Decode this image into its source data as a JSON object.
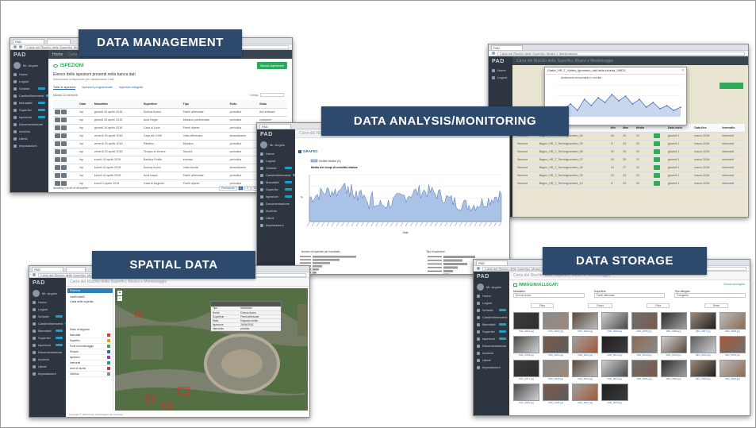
{
  "banners": {
    "data_management": "DATA MANAGEMENT",
    "data_analysis": "DATA ANALYSIS/MONITORING",
    "spatial_data": "SPATIAL DATA",
    "data_storage": "DATA STORAGE"
  },
  "app": {
    "logo": "PAD",
    "user_name": "Mr. Angelo",
    "user_sub": "Online",
    "header_title": "Carta del Rischio delle Superfici, Musivi e Monitoraggio",
    "nav": [
      "Home",
      "Logout",
      "Schede",
      "Cantieri/Interventi",
      "Manufatti",
      "Superfici",
      "Ispezioni",
      "Documentazione",
      "Archivio",
      "Utenti",
      "Impostazioni"
    ]
  },
  "management": {
    "section_title": "ISPEZIONI",
    "add_button": "Nuova Ispezione",
    "list_heading": "Elenco delle ispezioni presenti nella banca dati",
    "list_sub": "Selezionare un'ispezione per visualizzarne i dati",
    "tabs": [
      "Tutte le ispezioni",
      "Ispezioni programmate",
      "Ispezioni eseguite"
    ],
    "search_label": "Cerca:",
    "show_label": "Mostra 10 elementi",
    "columns": [
      "",
      "Data",
      "Manufatto",
      "Superficie",
      "Tipo",
      "Esito",
      "Stato"
    ],
    "rows": [
      [
        "Isp",
        "giovedì 26 aprile 2018",
        "Domus Aurea",
        "Pareti affrescate",
        "periodica",
        "da verificare"
      ],
      [
        "Isp",
        "giovedì 26 aprile 2018",
        "Aula Regia",
        "Mosaico pavimentale",
        "periodica",
        "conforme"
      ],
      [
        "Isp",
        "giovedì 26 aprile 2018",
        "Casa di Livia",
        "Pareti dipinte",
        "periodica",
        "da verificare"
      ],
      [
        "Isp",
        "venerdì 20 aprile 2018",
        "Casa dei Griffi",
        "Volta affrescata",
        "straordinaria",
        "conforme"
      ],
      [
        "Isp",
        "venerdì 20 aprile 2018",
        "Palatino",
        "Mosaico",
        "periodica",
        "conforme"
      ],
      [
        "Isp",
        "venerdì 20 aprile 2018",
        "Tempio di Venere",
        "Stucchi",
        "periodica",
        "conforme"
      ],
      [
        "Isp",
        "lunedì 16 aprile 2018",
        "Basilica Emilia",
        "Intonaci",
        "periodica",
        "da verificare"
      ],
      [
        "Isp",
        "lunedì 16 aprile 2018",
        "Domus Aurea",
        "Volta dorata",
        "straordinaria",
        "conforme"
      ],
      [
        "Isp",
        "lunedì 16 aprile 2018",
        "Aula Isiaca",
        "Pareti affrescate",
        "periodica",
        "conforme"
      ],
      [
        "Isp",
        "lunedì 9 aprile 2018",
        "Casa di Augusto",
        "Pareti dipinte",
        "periodica",
        "conforme"
      ]
    ],
    "footer": "Showing 1 to 10 of 48 entries",
    "pagination": [
      "Precedente",
      "1",
      "2",
      "3",
      "Successivo"
    ]
  },
  "analysis": {
    "section_title": "GRAFICI",
    "chart_title": "Media dei tempi di umidità relativa",
    "legend": "Umidità relativa (%)",
    "xlabel": "Data",
    "ylabel": "%",
    "bottom_left_title": "Numero di ispezioni per manufatto",
    "bottom_right_title": "Tipo di ispezione"
  },
  "monitor": {
    "popup_title": "Grafici_HR_T_Ninfeo_Igrometro_dati della scheda_UMDO",
    "popup_chart_title": "Andamento temperature e umidità",
    "table_columns": [
      "Sensore",
      "Nome",
      "Min",
      "Max",
      "Media",
      "",
      "Data inizio",
      "Data fine",
      "Intervallo"
    ],
    "rows": [
      [
        "Sensore",
        "Bagno_HR_T_Termoigrometro_04",
        "18",
        "25",
        "21",
        "giovedì 1",
        "marzo 2018",
        "interventi"
      ],
      [
        "Sensore",
        "Bagno_HR_T_Termoigrometro_05",
        "17",
        "24",
        "20",
        "giovedì 1",
        "marzo 2018",
        "interventi"
      ],
      [
        "Sensore",
        "Bagno_HR_T_Termoigrometro_06",
        "16",
        "26",
        "22",
        "giovedì 1",
        "marzo 2018",
        "interventi"
      ],
      [
        "Sensore",
        "Bagno_HR_T_Termoigrometro_07",
        "18",
        "25",
        "21",
        "giovedì 1",
        "marzo 2018",
        "interventi"
      ],
      [
        "Sensore",
        "Bagno_HR_T_Termoigrometro_08",
        "19",
        "27",
        "23",
        "giovedì 1",
        "marzo 2018",
        "interventi"
      ],
      [
        "Sensore",
        "Bagno_HR_T_Termoigrometro_09",
        "15",
        "23",
        "19",
        "giovedì 1",
        "marzo 2018",
        "interventi"
      ],
      [
        "Sensore",
        "Bagno_HR_T_Termoigrometro_10",
        "17",
        "24",
        "20",
        "giovedì 1",
        "marzo 2018",
        "interventi"
      ]
    ]
  },
  "spatial": {
    "panel_title": "Ricerca",
    "layer_label": "Livelli visibili",
    "basemap_label": "Carta delle superfici",
    "legend_title": "Stato di degrado",
    "layers": [
      "Manufatti",
      "Superfici",
      "Punti di monitoraggio",
      "Sensori",
      "Ispezioni",
      "Interventi",
      "Aree di rischio",
      "Ortofoto"
    ],
    "popup_rows": [
      [
        "Tipo",
        "Manufatto"
      ],
      [
        "Nome",
        "Domus Aurea"
      ],
      [
        "Superficie",
        "Pareti affrescate"
      ],
      [
        "Stato",
        "Degrado medio"
      ],
      [
        "Ispezione",
        "26/04/2018"
      ],
      [
        "Intervento",
        "previsto"
      ]
    ],
    "footer": "Copyright © 2018 Parco Archeologico del Colosseo"
  },
  "storage": {
    "section_title": "IMMAGINI/ALLEGATI",
    "add_button": "Nuova immagine",
    "filters": [
      "Manufatto",
      "Superficie",
      "Tipo allegato"
    ],
    "filter_values": [
      "Domus Aurea",
      "Pareti affrescate",
      "Fotografia"
    ],
    "search_buttons": [
      "Filtra",
      "Reset",
      "Filtra",
      "Reset"
    ],
    "captions": [
      "IMG_0001.jpg",
      "IMG_0002.jpg",
      "IMG_0003.jpg",
      "IMG_0004.jpg",
      "IMG_0005.jpg",
      "IMG_0006.jpg",
      "IMG_0007.jpg",
      "IMG_0008.jpg",
      "IMG_0009.jpg",
      "IMG_0010.jpg",
      "IMG_0011.jpg",
      "IMG_0012.jpg",
      "IMG_0013.jpg",
      "IMG_0014.jpg",
      "IMG_0015.jpg",
      "IMG_0016.jpg",
      "IMG_0017.jpg",
      "IMG_0018.jpg",
      "IMG_0019.jpg",
      "IMG_0020.jpg",
      "IMG_0021.jpg",
      "IMG_0022.jpg",
      "IMG_0023.jpg",
      "IMG_0024.jpg",
      "IMG_0025.jpg",
      "IMG_0026.jpg",
      "IMG_0027.jpg",
      "IMG_0028.jpg"
    ]
  },
  "colors": {
    "banner": "#2d4a6c",
    "sidebar": "#2c3540",
    "accent_green": "#2eaa5a",
    "chart_fill": "#a9c2e6",
    "chart_line": "#4a72b8"
  }
}
